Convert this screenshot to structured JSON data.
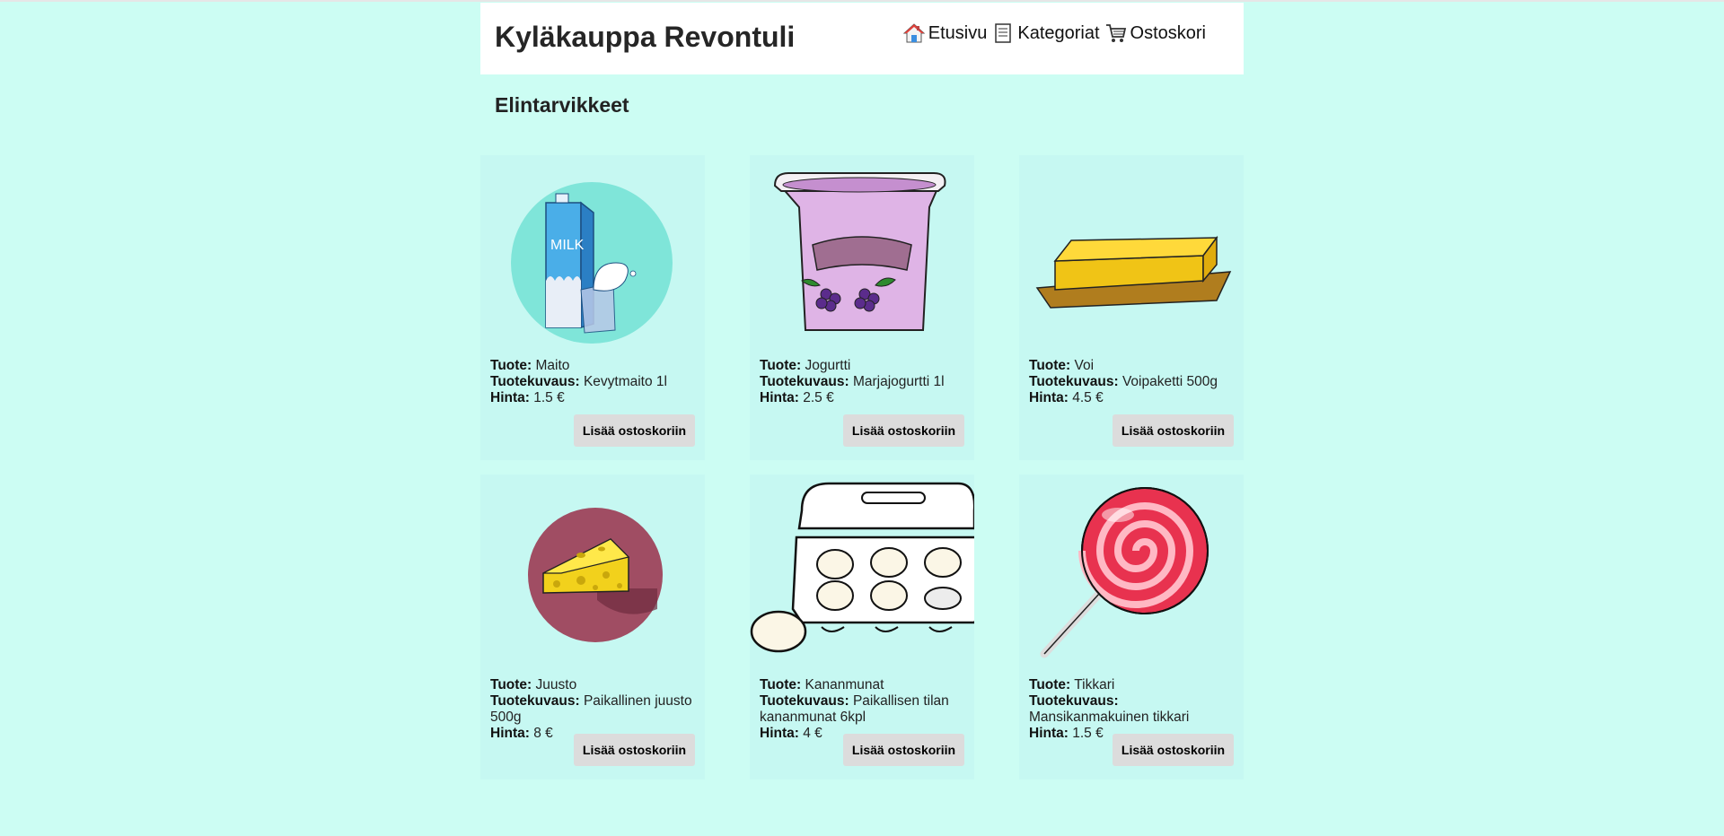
{
  "header": {
    "title": "Kyläkauppa Revontuli",
    "nav": [
      {
        "label": "Etusivu",
        "icon": "house-icon"
      },
      {
        "label": "Kategoriat",
        "icon": "document-icon"
      },
      {
        "label": "Ostoskori",
        "icon": "cart-icon"
      }
    ]
  },
  "category": {
    "title": "Elintarvikkeet"
  },
  "labels": {
    "product": "Tuote:",
    "description": "Tuotekuvaus:",
    "price": "Hinta:",
    "add_to_cart": "Lisää ostoskoriin"
  },
  "products": [
    {
      "name": "Maito",
      "description": "Kevytmaito 1l",
      "price": "1.5 €",
      "image": "milk-carton"
    },
    {
      "name": "Jogurtti",
      "description": "Marjajogurtti 1l",
      "price": "2.5 €",
      "image": "yogurt-cup"
    },
    {
      "name": "Voi",
      "description": "Voipaketti 500g",
      "price": "4.5 €",
      "image": "butter-block"
    },
    {
      "name": "Juusto",
      "description": "Paikallinen juusto 500g",
      "price": "8 €",
      "image": "cheese-wedge"
    },
    {
      "name": "Kananmunat",
      "description": "Paikallisen tilan kananmunat 6kpl",
      "price": "4 €",
      "image": "egg-carton"
    },
    {
      "name": "Tikkari",
      "description": "Mansikanmakuinen tikkari",
      "price": "1.5 €",
      "image": "lollipop"
    }
  ],
  "colors": {
    "background": "#ccfdf3",
    "card": "#c6f8f2",
    "button": "#dcdcdc"
  }
}
